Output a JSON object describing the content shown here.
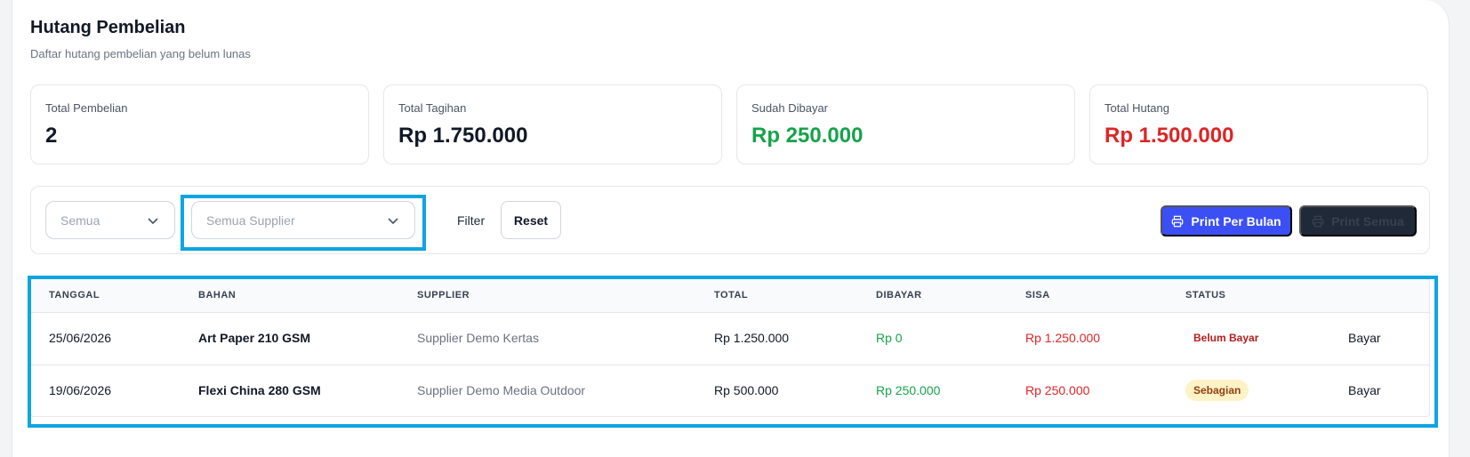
{
  "header": {
    "title": "Hutang Pembelian",
    "subtitle": "Daftar hutang pembelian yang belum lunas"
  },
  "stats": [
    {
      "label": "Total Pembelian",
      "value": "2",
      "color": "#111827"
    },
    {
      "label": "Total Tagihan",
      "value": "Rp 1.750.000",
      "color": "#111827"
    },
    {
      "label": "Sudah Dibayar",
      "value": "Rp 250.000",
      "color": "#16a34a"
    },
    {
      "label": "Total Hutang",
      "value": "Rp 1.500.000",
      "color": "#dc2626"
    }
  ],
  "filters": {
    "status_selected": "Semua",
    "supplier_selected": "Semua Supplier",
    "filter_label": "Filter",
    "reset_label": "Reset",
    "print_month_label": "Print Per Bulan",
    "print_all_label": "Print Semua"
  },
  "table": {
    "headers": {
      "tanggal": "TANGGAL",
      "bahan": "BAHAN",
      "supplier": "SUPPLIER",
      "total": "TOTAL",
      "dibayar": "DIBAYAR",
      "sisa": "SISA",
      "status": "STATUS"
    },
    "rows": [
      {
        "tanggal": "25/06/2026",
        "bahan": "Art Paper 210 GSM",
        "supplier": "Supplier Demo Kertas",
        "total": "Rp 1.250.000",
        "dibayar": "Rp 0",
        "sisa": "Rp 1.250.000",
        "status": "Belum Bayar",
        "action": "Bayar"
      },
      {
        "tanggal": "19/06/2026",
        "bahan": "Flexi China 280 GSM",
        "supplier": "Supplier Demo Media Outdoor",
        "total": "Rp 500.000",
        "dibayar": "Rp 250.000",
        "sisa": "Rp 250.000",
        "status": "Sebagian",
        "action": "Bayar"
      }
    ]
  },
  "colors": {
    "accent": "#3b4ff5",
    "highlight": "#0ea5e0",
    "paid": "#16a34a",
    "debt": "#dc2626"
  }
}
